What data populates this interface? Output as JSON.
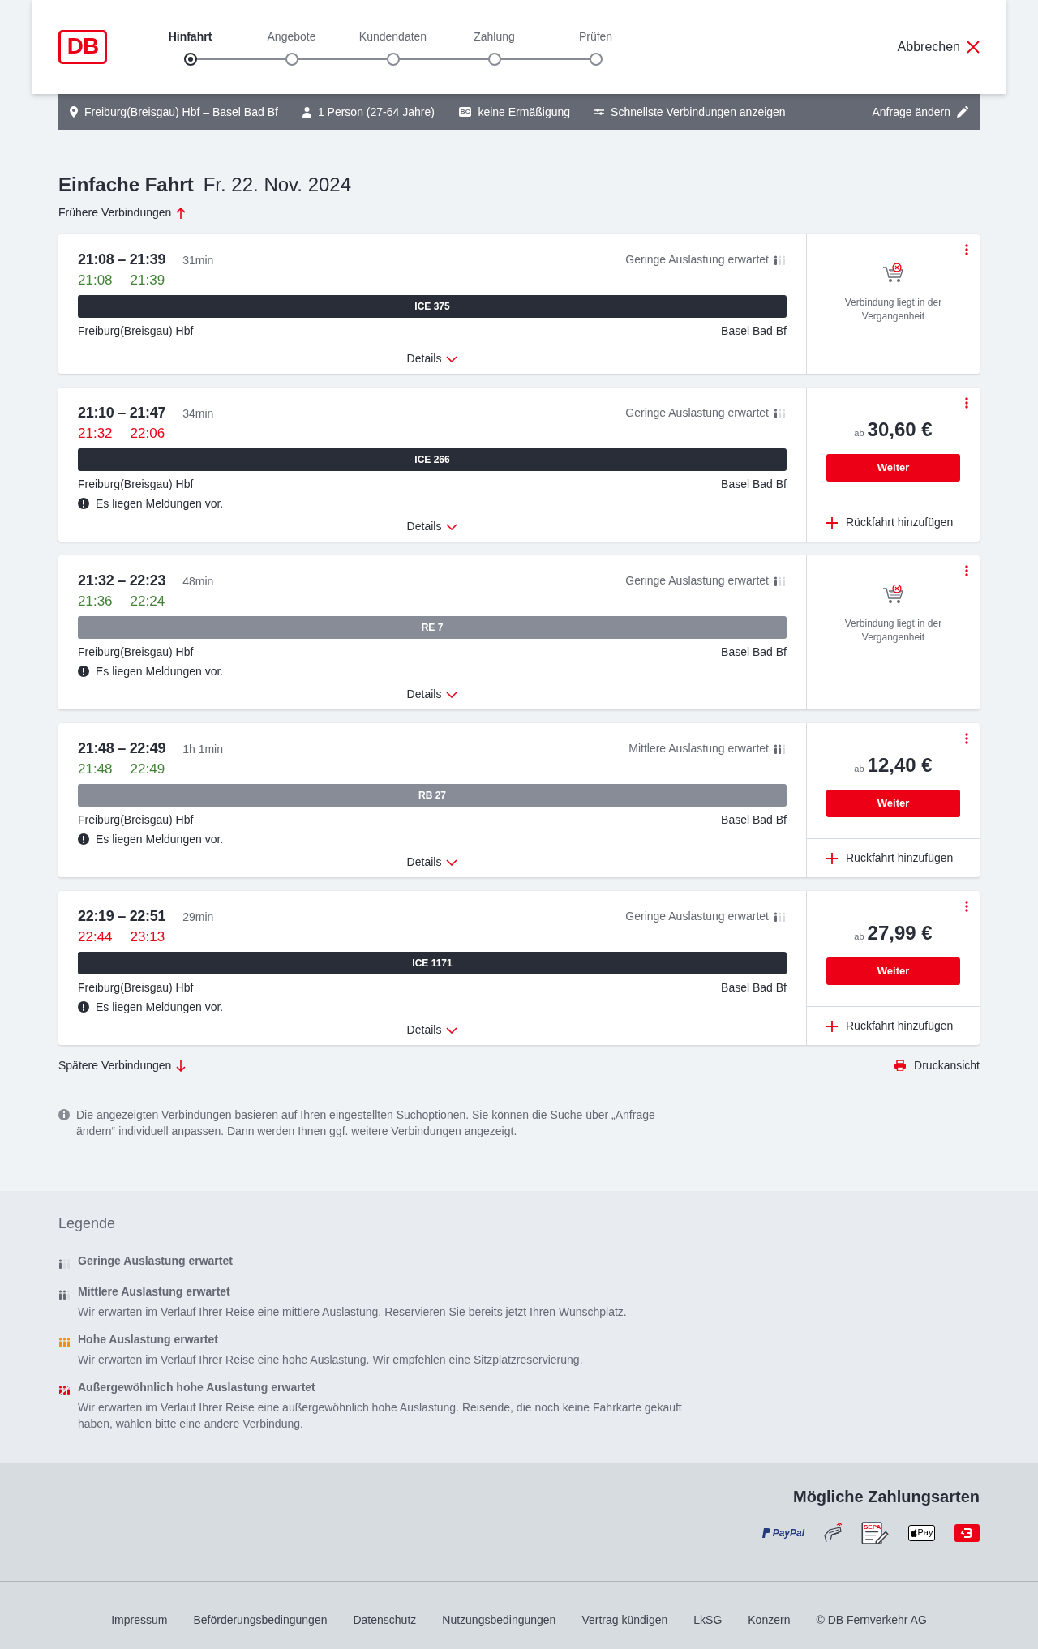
{
  "header": {
    "logo": "DB",
    "cancel": "Abbrechen",
    "steps": [
      {
        "label": "Hinfahrt",
        "selected": true
      },
      {
        "label": "Angebote",
        "selected": false
      },
      {
        "label": "Kundendaten",
        "selected": false
      },
      {
        "label": "Zahlung",
        "selected": false
      },
      {
        "label": "Prüfen",
        "selected": false
      }
    ]
  },
  "search_summary": {
    "route": "Freiburg(Breisgau) Hbf – Basel Bad Bf",
    "travellers": "1 Person (27-64 Jahre)",
    "card_badge": "BC",
    "discount": "keine Ermäßigung",
    "option": "Schnellste Verbindungen anzeigen",
    "edit": "Anfrage ändern"
  },
  "title": "Einfache Fahrt",
  "date": "Fr. 22. Nov. 2024",
  "earlier": "Frühere Verbindungen",
  "connections": [
    {
      "times": "21:08 – 21:39",
      "duration": "31min",
      "actual_departure": "21:08",
      "actual_arrival": "21:39",
      "delayed": false,
      "occupancy": {
        "kind": "low",
        "text": "Geringe Auslastung erwartet"
      },
      "train": {
        "kind": "long-distance",
        "name": "ICE 375"
      },
      "from": "Freiburg(Breisgau) Hbf",
      "to": "Basel Bad Bf",
      "details": "Details",
      "offer": {
        "kind": "past",
        "text": "Verbindung liegt in der Vergangenheit"
      }
    },
    {
      "times": "21:10 – 21:47",
      "duration": "34min",
      "actual_departure": "21:32",
      "actual_arrival": "22:06",
      "delayed": true,
      "occupancy": {
        "kind": "low",
        "text": "Geringe Auslastung erwartet"
      },
      "train": {
        "kind": "long-distance",
        "name": "ICE 266"
      },
      "from": "Freiburg(Breisgau) Hbf",
      "to": "Basel Bad Bf",
      "message": "Es liegen Meldungen vor.",
      "details": "Details",
      "offer": {
        "kind": "price",
        "prefix": "ab",
        "price": "30,60 €",
        "button": "Weiter",
        "return": "Rückfahrt hinzufügen"
      }
    },
    {
      "times": "21:32 – 22:23",
      "duration": "48min",
      "actual_departure": "21:36",
      "actual_arrival": "22:24",
      "delayed": false,
      "occupancy": {
        "kind": "low",
        "text": "Geringe Auslastung erwartet"
      },
      "train": {
        "kind": "regional",
        "name": "RE 7"
      },
      "from": "Freiburg(Breisgau) Hbf",
      "to": "Basel Bad Bf",
      "message": "Es liegen Meldungen vor.",
      "details": "Details",
      "offer": {
        "kind": "past",
        "text": "Verbindung liegt in der Vergangenheit"
      }
    },
    {
      "times": "21:48 – 22:49",
      "duration": "1h 1min",
      "actual_departure": "21:48",
      "actual_arrival": "22:49",
      "delayed": false,
      "occupancy": {
        "kind": "medium",
        "text": "Mittlere Auslastung erwartet"
      },
      "train": {
        "kind": "regional",
        "name": "RB 27"
      },
      "from": "Freiburg(Breisgau) Hbf",
      "to": "Basel Bad Bf",
      "message": "Es liegen Meldungen vor.",
      "details": "Details",
      "offer": {
        "kind": "price",
        "prefix": "ab",
        "price": "12,40 €",
        "button": "Weiter",
        "return": "Rückfahrt hinzufügen"
      }
    },
    {
      "times": "22:19 – 22:51",
      "duration": "29min",
      "actual_departure": "22:44",
      "actual_arrival": "23:13",
      "delayed": true,
      "occupancy": {
        "kind": "low",
        "text": "Geringe Auslastung erwartet"
      },
      "train": {
        "kind": "long-distance",
        "name": "ICE 1171"
      },
      "from": "Freiburg(Breisgau) Hbf",
      "to": "Basel Bad Bf",
      "message": "Es liegen Meldungen vor.",
      "details": "Details",
      "offer": {
        "kind": "price",
        "prefix": "ab",
        "price": "27,99 €",
        "button": "Weiter",
        "return": "Rückfahrt hinzufügen"
      }
    }
  ],
  "later": "Spätere Verbindungen",
  "print": "Druckansicht",
  "notice": "Die angezeigten Verbindungen basieren auf Ihren eingestellten Suchoptionen. Sie können die Suche über „Anfrage ändern“ individuell anpassen. Dann werden Ihnen ggf. weitere Verbindungen angezeigt.",
  "legend": {
    "title": "Legende",
    "items": [
      {
        "kind": "low",
        "title": "Geringe Auslastung erwartet"
      },
      {
        "kind": "medium",
        "title": "Mittlere Auslastung erwartet",
        "text": "Wir erwarten im Verlauf Ihrer Reise eine mittlere Auslastung. Reservieren Sie bereits jetzt Ihren Wunschplatz."
      },
      {
        "kind": "high",
        "title": "Hohe Auslastung erwartet",
        "text": "Wir erwarten im Verlauf Ihrer Reise eine hohe Auslastung. Wir empfehlen eine Sitzplatzreservierung."
      },
      {
        "kind": "extreme",
        "title": "Außergewöhnlich hohe Auslastung erwartet",
        "text": "Wir erwarten im Verlauf Ihrer Reise eine außergewöhnlich hohe Auslastung. Reisende, die noch keine Fahrkarte gekauft haben, wählen bitte eine andere Verbindung."
      }
    ]
  },
  "payment": {
    "title": "Mögliche Zahlungsarten",
    "methods": [
      {
        "kind": "paypal",
        "label": "PayPal"
      },
      {
        "kind": "card"
      },
      {
        "kind": "sepa",
        "label": "SEPA"
      },
      {
        "kind": "applepay",
        "label": "Pay"
      },
      {
        "kind": "db"
      }
    ]
  },
  "footer": {
    "links": [
      "Impressum",
      "Beförderungsbedingungen",
      "Datenschutz",
      "Nutzungsbedingungen",
      "Vertrag kündigen",
      "LkSG",
      "Konzern",
      "© DB Fernverkehr AG"
    ]
  }
}
